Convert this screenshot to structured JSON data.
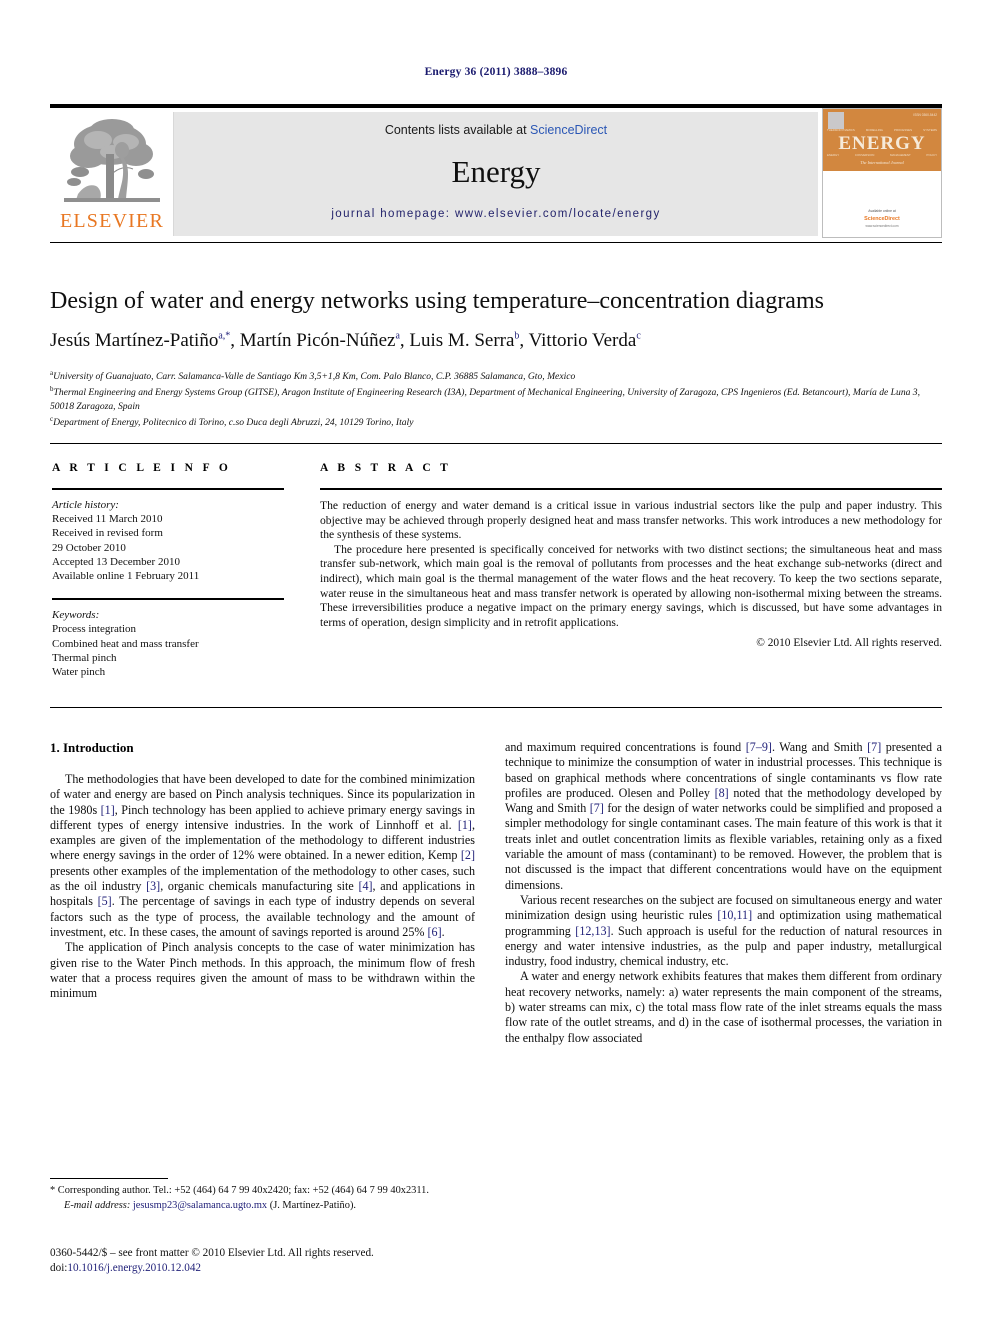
{
  "running_head": "Energy 36 (2011) 3888–3896",
  "masthead": {
    "contents_prefix": "Contents lists available at ",
    "sciencedirect": "ScienceDirect",
    "journal_name": "Energy",
    "homepage": "journal homepage: www.elsevier.com/locate/energy",
    "publisher_wordmark": "ELSEVIER",
    "publisher_logo_icon": "elsevier-tree-icon",
    "cover": {
      "title": "ENERGY",
      "subtitle": "The International Journal",
      "issn": "ISSN 0360-5442",
      "words_top": [
        "THERMODYNAMICS",
        "MODELLING",
        "PROCESSES",
        "SYSTEMS"
      ],
      "words_bottom": [
        "ENERGY",
        "CONVERSION",
        "MANAGEMENT",
        "POLICY"
      ],
      "available_at": "Available online at",
      "platform": "ScienceDirect",
      "url": "www.sciencedirect.com"
    }
  },
  "article": {
    "title": "Design of water and energy networks using temperature–concentration diagrams",
    "authors": [
      {
        "name": "Jesús Martínez-Patiño",
        "marks": "a,*"
      },
      {
        "name": "Martín Picón-Núñez",
        "marks": "a"
      },
      {
        "name": "Luis M. Serra",
        "marks": "b"
      },
      {
        "name": "Vittorio Verda",
        "marks": "c"
      }
    ],
    "affiliations": [
      {
        "mark": "a",
        "text": "University of Guanajuato, Carr. Salamanca-Valle de Santiago Km 3,5+1,8 Km, Com. Palo Blanco, C.P. 36885 Salamanca, Gto, Mexico"
      },
      {
        "mark": "b",
        "text": "Thermal Engineering and Energy Systems Group (GITSE), Aragon Institute of Engineering Research (I3A), Department of Mechanical Engineering, University of Zaragoza, CPS Ingenieros (Ed. Betancourt), María de Luna 3, 50018 Zaragoza, Spain"
      },
      {
        "mark": "c",
        "text": "Department of Energy, Politecnico di Torino, c.so Duca degli Abruzzi, 24, 10129 Torino, Italy"
      }
    ]
  },
  "article_info": {
    "heading": "A R T I C L E   I N F O",
    "history_label": "Article history:",
    "history": [
      "Received 11 March 2010",
      "Received in revised form",
      "29 October 2010",
      "Accepted 13 December 2010",
      "Available online 1 February 2011"
    ],
    "keywords_label": "Keywords:",
    "keywords": [
      "Process integration",
      "Combined heat and mass transfer",
      "Thermal pinch",
      "Water pinch"
    ]
  },
  "abstract": {
    "heading": "A B S T R A C T",
    "paragraphs": [
      "The reduction of energy and water demand is a critical issue in various industrial sectors like the pulp and paper industry. This objective may be achieved through properly designed heat and mass transfer networks. This work introduces a new methodology for the synthesis of these systems.",
      "The procedure here presented is specifically conceived for networks with two distinct sections; the simultaneous heat and mass transfer sub-network, which main goal is the removal of pollutants from processes and the heat exchange sub-networks (direct and indirect), which main goal is the thermal management of the water flows and the heat recovery. To keep the two sections separate, water reuse in the simultaneous heat and mass transfer network is operated by allowing non-isothermal mixing between the streams. These irreversibilities produce a negative impact on the primary energy savings, which is discussed, but have some advantages in terms of operation, design simplicity and in retrofit applications."
    ],
    "copyright": "© 2010 Elsevier Ltd. All rights reserved."
  },
  "body": {
    "section_heading": "1.  Introduction",
    "left_column": [
      "The methodologies that have been developed to date for the combined minimization of water and energy are based on Pinch analysis techniques. Since its popularization in the 1980s [1], Pinch technology has been applied to achieve primary energy savings in different types of energy intensive industries. In the work of Linnhoff et al. [1], examples are given of the implementation of the methodology to different industries where energy savings in the order of 12% were obtained. In a newer edition, Kemp [2] presents other examples of the implementation of the methodology to other cases, such as the oil industry [3], organic chemicals manufacturing site [4], and applications in hospitals [5]. The percentage of savings in each type of industry depends on several factors such as the type of process, the available technology and the amount of investment, etc. In these cases, the amount of savings reported is around 25% [6].",
      "The application of Pinch analysis concepts to the case of water minimization has given rise to the Water Pinch methods. In this approach, the minimum flow of fresh water that a process requires given the amount of mass to be withdrawn within the minimum"
    ],
    "right_column": [
      "and maximum required concentrations is found [7–9]. Wang and Smith [7] presented a technique to minimize the consumption of water in industrial processes. This technique is based on graphical methods where concentrations of single contaminants vs flow rate profiles are produced. Olesen and Polley [8] noted that the methodology developed by Wang and Smith [7] for the design of water networks could be simplified and proposed a simpler methodology for single contaminant cases. The main feature of this work is that it treats inlet and outlet concentration limits as flexible variables, retaining only as a fixed variable the amount of mass (contaminant) to be removed. However, the problem that is not discussed is the impact that different concentrations would have on the equipment dimensions.",
      "Various recent researches on the subject are focused on simultaneous energy and water minimization design using heuristic rules [10,11] and optimization using mathematical programming [12,13]. Such approach is useful for the reduction of natural resources in energy and water intensive industries, as the pulp and paper industry, metallurgical industry, food industry, chemical industry, etc.",
      "A water and energy network exhibits features that makes them different from ordinary heat recovery networks, namely: a) water represents the main component of the streams, b) water streams can mix, c) the total mass flow rate of the inlet streams equals the mass flow rate of the outlet streams, and d) in the case of isothermal processes, the variation in the enthalpy flow associated"
    ]
  },
  "footnotes": {
    "corresponding": "* Corresponding author. Tel.: +52 (464) 64 7 99 40x2420; fax: +52 (464) 64 7 99 40x2311.",
    "email_label": "E-mail address:",
    "email": "jesusmp23@salamanca.ugto.mx",
    "email_suffix": "(J. Martínez-Patiño).",
    "issn_line": "0360-5442/$ – see front matter © 2010 Elsevier Ltd. All rights reserved.",
    "doi_label": "doi:",
    "doi": "10.1016/j.energy.2010.12.042"
  },
  "colors": {
    "elsevier_orange": "#e87722",
    "link_blue": "#23237a",
    "sciencedirect_blue": "#2b57b5",
    "cover_orange": "#d2873f",
    "band_gray": "#e6e6e6"
  }
}
